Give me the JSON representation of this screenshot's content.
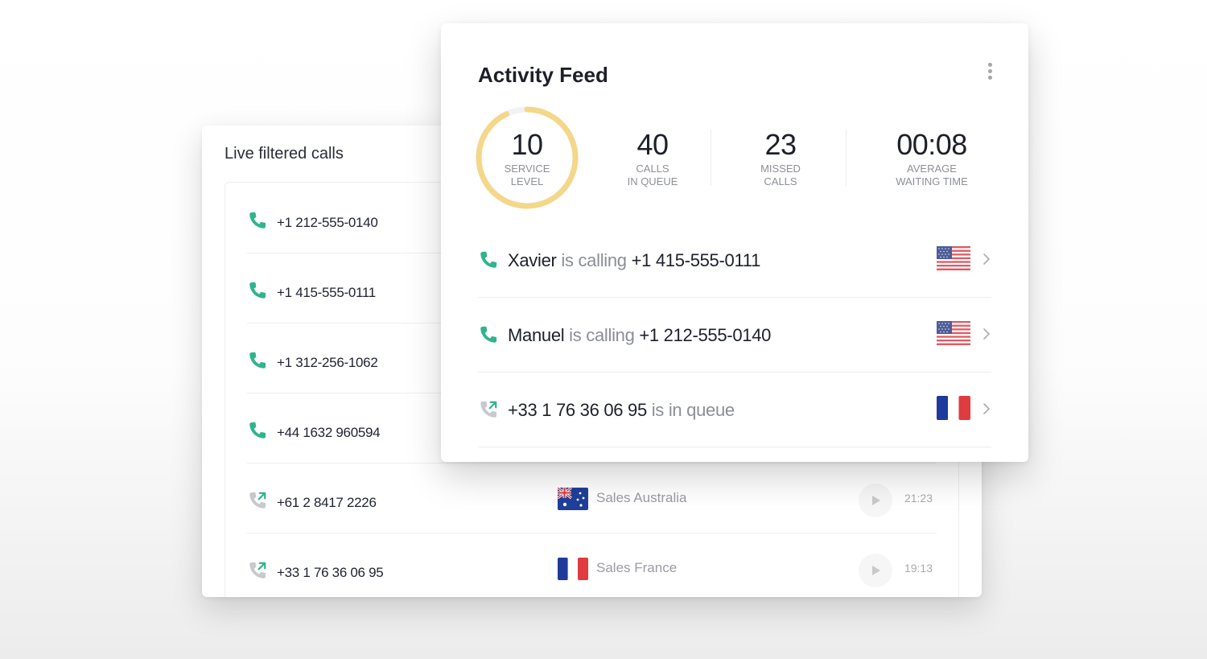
{
  "live_calls": {
    "title": "Live filtered calls",
    "rows": [
      {
        "number": "+1 212-555-0140",
        "status": "active",
        "queue": "",
        "flag": "",
        "time": ""
      },
      {
        "number": "+1 415-555-0111",
        "status": "active",
        "queue": "",
        "flag": "",
        "time": ""
      },
      {
        "number": "+1 312-256-1062",
        "status": "active",
        "queue": "",
        "flag": "",
        "time": ""
      },
      {
        "number": "+44 1632 960594",
        "status": "active",
        "queue": "",
        "flag": "",
        "time": ""
      },
      {
        "number": "+61 2 8417 2226",
        "status": "incoming",
        "queue": "Sales Australia",
        "flag": "australia-flag-icon",
        "time": "21:23"
      },
      {
        "number": "+33 1 76 36 06 95",
        "status": "incoming",
        "queue": "Sales France",
        "flag": "france-flag-icon",
        "time": "19:13"
      }
    ]
  },
  "activity_feed": {
    "title": "Activity Feed",
    "stats": {
      "service_level": {
        "value": "10",
        "label_line1": "SERVICE",
        "label_line2": "LEVEL",
        "progress_percent": 93
      },
      "calls_in_queue": {
        "value": "40",
        "label_line1": "CALLS",
        "label_line2": "IN QUEUE"
      },
      "missed_calls": {
        "value": "23",
        "label_line1": "MISSED",
        "label_line2": "CALLS"
      },
      "average_waiting_time": {
        "value": "00:08",
        "label_line1": "AVERAGE",
        "label_line2": "WAITING TIME"
      }
    },
    "feed": [
      {
        "name": "Xavier",
        "action": " is calling ",
        "number": "+1 415-555-0111",
        "flag": "us-flag-icon",
        "status": "active"
      },
      {
        "name": "Manuel",
        "action": " is calling ",
        "number": "+1 212-555-0140",
        "flag": "us-flag-icon",
        "status": "active"
      },
      {
        "name": "",
        "number": "+33 1 76 36 06 95",
        "action": " is in queue",
        "flag": "france-flag-icon",
        "status": "incoming"
      }
    ]
  },
  "colors": {
    "call_green": "#2fb48d",
    "incoming_gray": "#c7c9cd",
    "gauge_yellow": "#f5d78a",
    "gauge_track": "#f2f2f2"
  }
}
